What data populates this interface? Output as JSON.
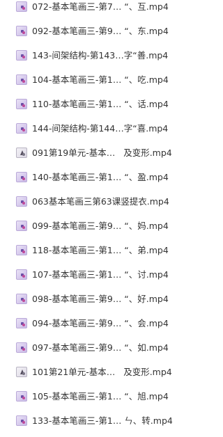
{
  "files": [
    {
      "name": "072-基本笔画三-第7… “、互.mp4",
      "icon": "video-thumbnail-icon"
    },
    {
      "name": "092-基本笔画三-第9… “、东.mp4",
      "icon": "video-thumbnail-icon"
    },
    {
      "name": "143-间架结构-第143…字“善.mp4",
      "icon": "video-thumbnail-icon"
    },
    {
      "name": "104-基本笔画三-第1… “、吃.mp4",
      "icon": "video-thumbnail-icon"
    },
    {
      "name": "110-基本笔画三-第1… “、话.mp4",
      "icon": "video-thumbnail-icon"
    },
    {
      "name": "144-间架结构-第144…字“喜.mp4",
      "icon": "video-thumbnail-icon"
    },
    {
      "name": "091第19单元-基本…   及变形.mp4",
      "icon": "video-thumbnail-light-icon"
    },
    {
      "name": "140-基本笔画三-第1… “、盈.mp4",
      "icon": "video-thumbnail-icon"
    },
    {
      "name": "063基本笔画三第63课竖提衣.mp4",
      "icon": "video-thumbnail-icon"
    },
    {
      "name": "099-基本笔画三-第9… “、妈.mp4",
      "icon": "video-thumbnail-icon"
    },
    {
      "name": "118-基本笔画三-第1… “、弟.mp4",
      "icon": "video-thumbnail-icon"
    },
    {
      "name": "107-基本笔画三-第1… “、讨.mp4",
      "icon": "video-thumbnail-icon"
    },
    {
      "name": "098-基本笔画三-第9… “、好.mp4",
      "icon": "video-thumbnail-icon"
    },
    {
      "name": "094-基本笔画三-第9… “、会.mp4",
      "icon": "video-thumbnail-icon"
    },
    {
      "name": "097-基本笔画三-第9… “、如.mp4",
      "icon": "video-thumbnail-icon"
    },
    {
      "name": "101第21单元-基本…   及变形.mp4",
      "icon": "video-thumbnail-light-icon"
    },
    {
      "name": "105-基本笔画三-第1… “、旭.mp4",
      "icon": "video-thumbnail-icon"
    },
    {
      "name": "133-基本笔画三-第1… ㄣ、转.mp4",
      "icon": "video-thumbnail-icon"
    }
  ]
}
